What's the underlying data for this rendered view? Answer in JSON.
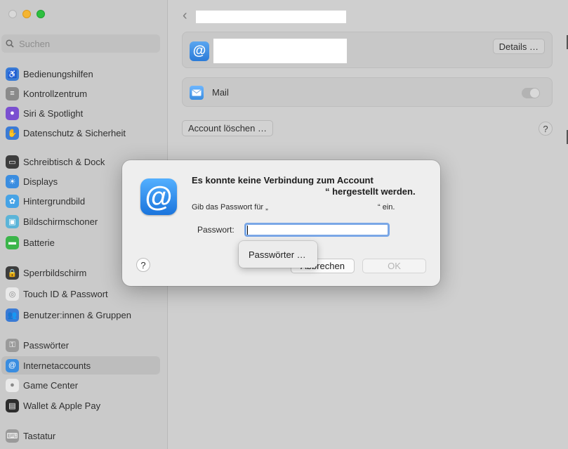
{
  "sidebar": {
    "search_placeholder": "Suchen",
    "items": [
      {
        "label": "Bedienungshilfen",
        "icon": "accessibility-icon",
        "color": "#3a7bd5"
      },
      {
        "label": "Kontrollzentrum",
        "icon": "control-center-icon",
        "color": "#8a8a8a"
      },
      {
        "label": "Siri & Spotlight",
        "icon": "siri-icon",
        "color": "#7a4fd0"
      },
      {
        "label": "Datenschutz & Sicherheit",
        "icon": "privacy-hand-icon",
        "color": "#3a7bd5"
      },
      {
        "label": "Schreibtisch & Dock",
        "icon": "desktop-dock-icon",
        "color": "#3d3d3d"
      },
      {
        "label": "Displays",
        "icon": "displays-icon",
        "color": "#3a8de0"
      },
      {
        "label": "Hintergrundbild",
        "icon": "wallpaper-icon",
        "color": "#46a3e6"
      },
      {
        "label": "Bildschirmschoner",
        "icon": "screensaver-icon",
        "color": "#5bb4d8"
      },
      {
        "label": "Batterie",
        "icon": "battery-icon",
        "color": "#3bb54a"
      },
      {
        "label": "Sperrbildschirm",
        "icon": "lock-screen-icon",
        "color": "#3d3d3d"
      },
      {
        "label": "Touch ID & Passwort",
        "icon": "fingerprint-icon",
        "color": "#e9e9e9"
      },
      {
        "label": "Benutzer:innen & Gruppen",
        "icon": "users-groups-icon",
        "color": "#3a7bd5"
      },
      {
        "label": "Passwörter",
        "icon": "key-icon",
        "color": "#9a9a9a"
      },
      {
        "label": "Internetaccounts",
        "icon": "at-sign-icon",
        "color": "#3a8de0"
      },
      {
        "label": "Game Center",
        "icon": "game-center-icon",
        "color": "#e9e9e9"
      },
      {
        "label": "Wallet & Apple Pay",
        "icon": "wallet-icon",
        "color": "#2d2d2d"
      },
      {
        "label": "Tastatur",
        "icon": "keyboard-icon",
        "color": "#9a9a9a"
      }
    ]
  },
  "main": {
    "details_label": "Details …",
    "mail_label": "Mail",
    "delete_label": "Account löschen …",
    "help_label": "?"
  },
  "dialog": {
    "title_line1": "Es konnte keine Verbindung zum Account",
    "title_line2": "“ hergestellt werden.",
    "message_part1": "Gib das Passwort für „",
    "message_part2": "“ ein.",
    "password_label": "Passwort:",
    "help_label": "?",
    "cancel_label": "Abbrechen",
    "ok_label": "OK"
  },
  "popup": {
    "label": "Passwörter …"
  }
}
